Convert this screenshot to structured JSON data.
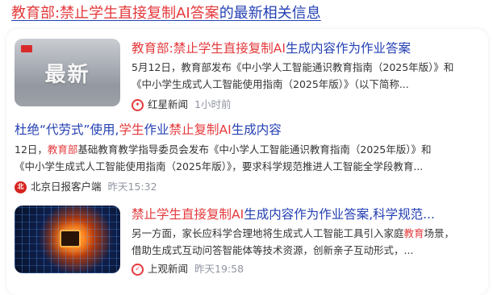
{
  "header": {
    "title_highlight": "教育部:禁止学生直接复制AI答案",
    "title_rest": "的最新相关信息"
  },
  "items": [
    {
      "thumb_text": "最新",
      "title_parts": [
        "教育部",
        ":",
        "禁止学生直接复制AI",
        "生成内容作为作业答案"
      ],
      "desc_line1": "5月12日，教育部发布《中小学人工智能通识教育指南（2025年版）》和",
      "desc_line2": "《中小学生成式人工智能使用指南（2025年版）》（以下简称...",
      "source": "红星新闻",
      "time": "1小时前",
      "logo": "red-star-logo-icon"
    },
    {
      "title_parts": [
        "杜绝“代劳式”使用,",
        "学生",
        "作业",
        "禁止复制AI",
        "生成内容"
      ],
      "desc_prefix": "12日，",
      "desc_em": "教育部",
      "desc_line1_rest": "基础教育教学指导委员会发布《中小学人工智能通识教育指南（2025年版）》和",
      "desc_line2": "《中小学生成式人工智能使用指南（2025年版）》，要求科学规范推进人工智能全学段教育...",
      "source": "北京日报客户端",
      "time": "昨天15:32",
      "logo": "beijing-daily-logo-icon"
    },
    {
      "title_parts": [
        "禁止学生直接复制AI",
        "生成内容作为作业答案",
        ",科学规范..."
      ],
      "desc_line1_pre": "另一方面，家长应科学合理地将生成式人工智能工具引入家庭",
      "desc_line1_em": "教育",
      "desc_line1_post": "场景，",
      "desc_line2": "借助生成式互动问答智能体等技术资源，创新亲子互动形式，...",
      "source": "上观新闻",
      "time": "昨天19:58",
      "logo": "shangguan-logo-icon"
    }
  ],
  "colors": {
    "highlight": "#e4393c",
    "link": "#2440b3",
    "muted": "#9195a3"
  }
}
